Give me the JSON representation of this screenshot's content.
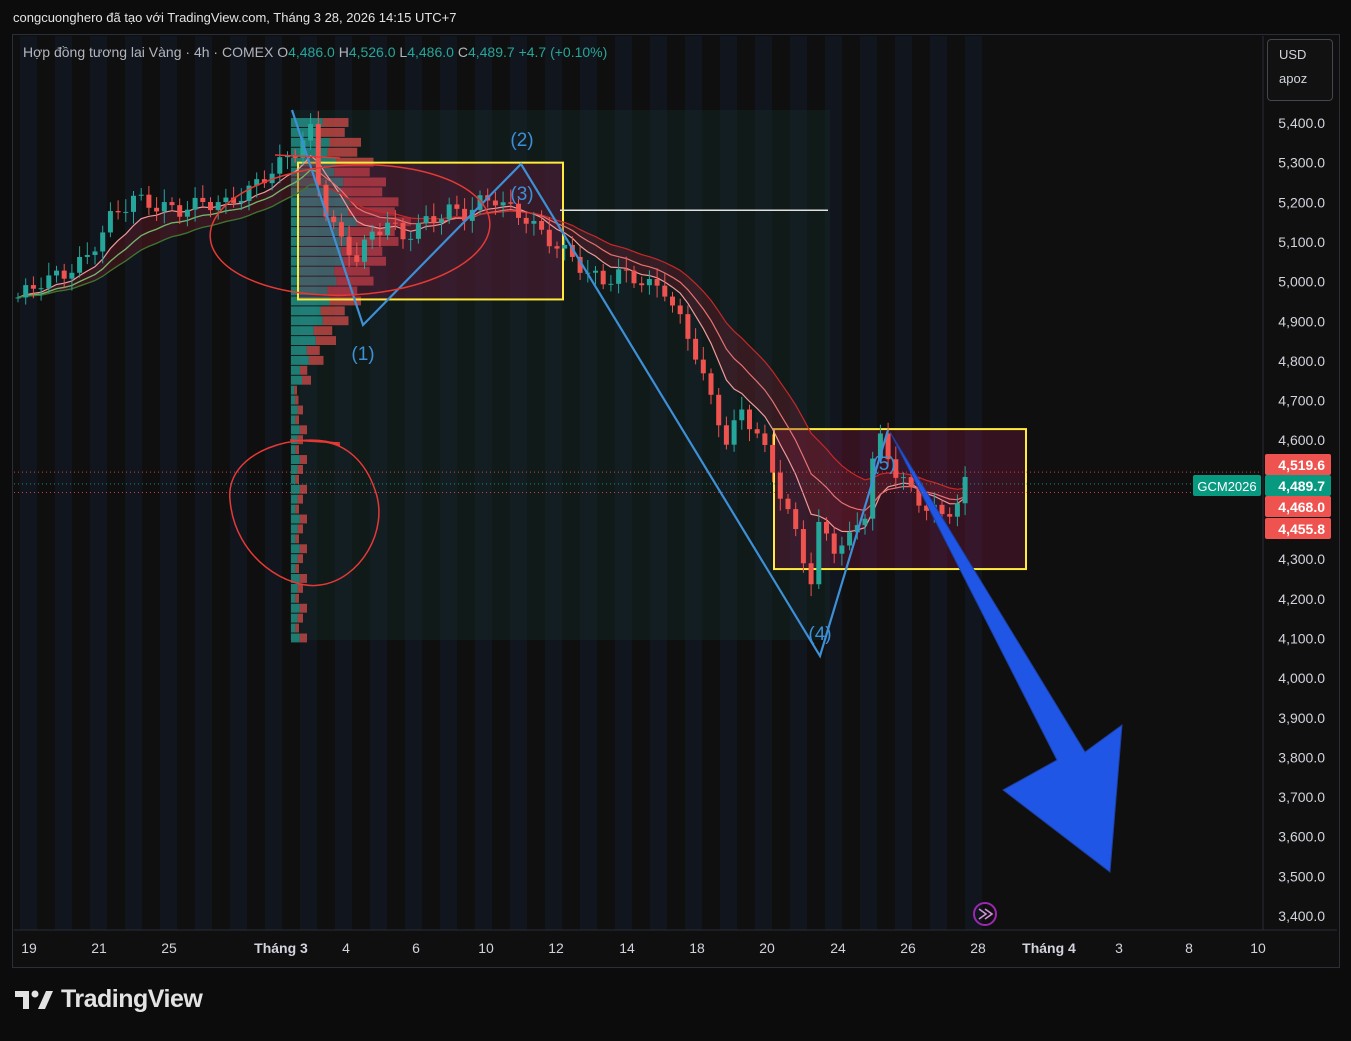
{
  "header": {
    "attribution": "congcuonghero đã tạo với TradingView.com, Tháng 3 28, 2026 14:15 UTC+7"
  },
  "legend": {
    "symbol": "Hợp đồng tương lai Vàng · 4h · COMEX",
    "o_label": "O",
    "o_value": "4,486.0",
    "h_label": "H",
    "h_value": "4,526.0",
    "l_label": "L",
    "l_value": "4,486.0",
    "c_label": "C",
    "c_value": "4,489.7",
    "change": "+4.7 (+0.10%)"
  },
  "currency_box": {
    "currency": "USD",
    "user": "apoz"
  },
  "brand": {
    "name": "TradingView"
  },
  "colors": {
    "up": "#26a69a",
    "down": "#ef5350",
    "background": "#0f0f0f",
    "drawing_line": "#3d8fd6",
    "rectangle_border": "#ffeb3b",
    "ellipse": "#e53935",
    "arrow": "#1f56e6",
    "grid": "#1a1d24"
  },
  "chart_data": {
    "type": "candlestick",
    "symbol_tag": "GCM2026",
    "y_axis": {
      "ticks": [
        3400,
        3500,
        3600,
        3700,
        3800,
        3900,
        4000,
        4100,
        4200,
        4300,
        4400,
        4500,
        4600,
        4700,
        4800,
        4900,
        5000,
        5100,
        5200,
        5300,
        5400
      ],
      "tick_labels": [
        "3,400.0",
        "3,500.0",
        "3,600.0",
        "3,700.0",
        "3,800.0",
        "3,900.0",
        "4,000.0",
        "4,100.0",
        "4,200.0",
        "4,300.0",
        "",
        "",
        "4,600.0",
        "4,700.0",
        "4,800.0",
        "4,900.0",
        "5,000.0",
        "5,100.0",
        "5,200.0",
        "5,300.0",
        "5,400.0"
      ],
      "range": [
        3380,
        5450
      ]
    },
    "x_axis": {
      "labels": [
        "19",
        "21",
        "25",
        "Tháng 3",
        "4",
        "6",
        "10",
        "12",
        "14",
        "18",
        "20",
        "24",
        "26",
        "28",
        "Tháng 4",
        "3",
        "8",
        "10"
      ]
    },
    "price_labels": [
      {
        "value": 4519.6,
        "text": "4,519.6",
        "color": "#ef5350"
      },
      {
        "value": 4489.7,
        "text": "4,489.7",
        "color": "#089981"
      },
      {
        "value": 4468.0,
        "text": "4,468.0",
        "color": "#ef5350"
      },
      {
        "value": 4455.8,
        "text": "4,455.8",
        "color": "#ef5350"
      }
    ],
    "close_path": [
      [
        0,
        4960
      ],
      [
        3,
        5000
      ],
      [
        6,
        5020
      ],
      [
        9,
        5060
      ],
      [
        12,
        5160
      ],
      [
        15,
        5210
      ],
      [
        18,
        5190
      ],
      [
        21,
        5180
      ],
      [
        24,
        5200
      ],
      [
        27,
        5195
      ],
      [
        30,
        5230
      ],
      [
        33,
        5280
      ],
      [
        36,
        5330
      ],
      [
        38,
        5380
      ],
      [
        39,
        5250
      ],
      [
        40,
        5180
      ],
      [
        42,
        5100
      ],
      [
        44,
        5060
      ],
      [
        46,
        5120
      ],
      [
        48,
        5150
      ],
      [
        50,
        5110
      ],
      [
        52,
        5140
      ],
      [
        54,
        5160
      ],
      [
        56,
        5180
      ],
      [
        58,
        5170
      ],
      [
        60,
        5200
      ],
      [
        62,
        5210
      ],
      [
        64,
        5180
      ],
      [
        66,
        5160
      ],
      [
        68,
        5120
      ],
      [
        70,
        5090
      ],
      [
        72,
        5060
      ],
      [
        74,
        5020
      ],
      [
        76,
        5000
      ],
      [
        78,
        5020
      ],
      [
        80,
        5010
      ],
      [
        82,
        4990
      ],
      [
        84,
        4980
      ],
      [
        86,
        4900
      ],
      [
        88,
        4820
      ],
      [
        90,
        4700
      ],
      [
        92,
        4600
      ],
      [
        94,
        4670
      ],
      [
        96,
        4620
      ],
      [
        98,
        4520
      ],
      [
        100,
        4420
      ],
      [
        102,
        4300
      ],
      [
        103,
        4250
      ],
      [
        104,
        4380
      ],
      [
        106,
        4330
      ],
      [
        108,
        4350
      ],
      [
        110,
        4420
      ],
      [
        111,
        4550
      ],
      [
        112,
        4600
      ],
      [
        114,
        4520
      ],
      [
        116,
        4470
      ],
      [
        118,
        4430
      ],
      [
        120,
        4410
      ],
      [
        122,
        4440
      ],
      [
        123,
        4489.7
      ]
    ],
    "annotations": [
      {
        "type": "wave_label",
        "text": "(1)"
      },
      {
        "type": "wave_label",
        "text": "(2)"
      },
      {
        "type": "wave_label",
        "text": "(3)"
      },
      {
        "type": "wave_label",
        "text": "(4)"
      },
      {
        "type": "wave_label",
        "text": "(5)"
      }
    ],
    "horizontal_level": 5180,
    "grid": false,
    "legend_position": "top-left"
  }
}
